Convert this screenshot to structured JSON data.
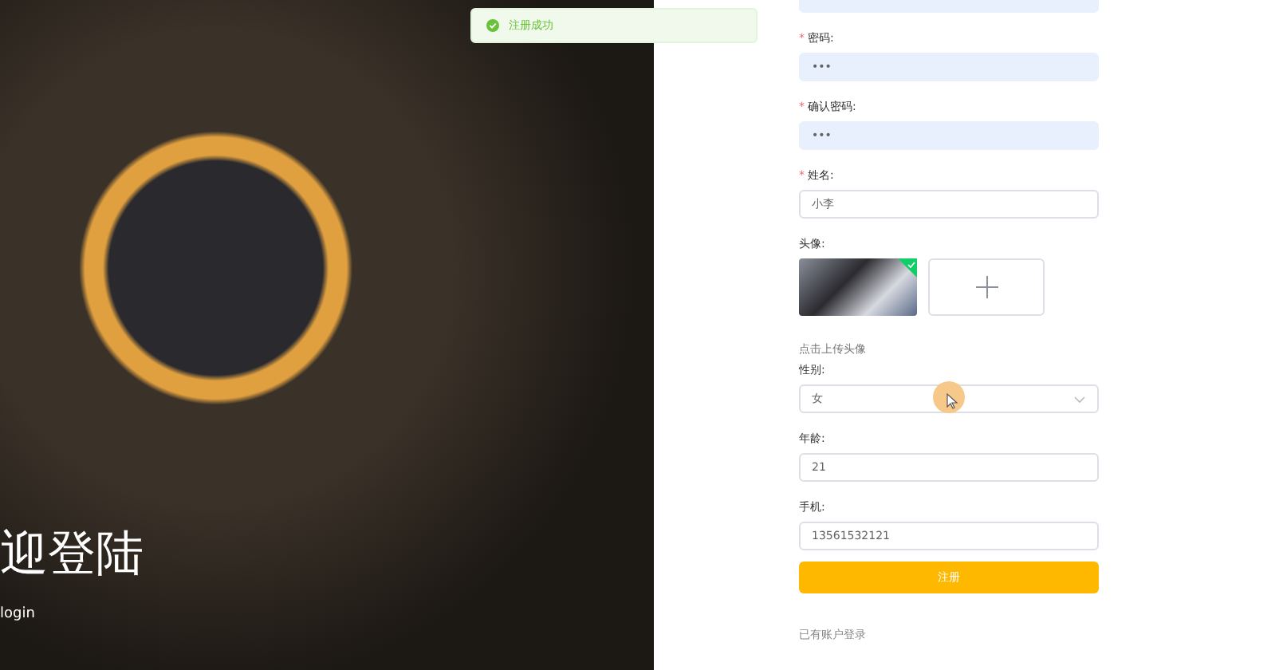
{
  "hero": {
    "title": "迎登陆",
    "subtitle": "login"
  },
  "toast": {
    "kind": "success",
    "text": "注册成功"
  },
  "form": {
    "fields": [
      {
        "kind": "input",
        "autofilled": true
      },
      {
        "kind": "input",
        "required_mark": "*",
        "label": "密码:",
        "value": "•••",
        "autofilled": true
      },
      {
        "kind": "input",
        "required_mark": "*",
        "label": "确认密码:",
        "value": "•••",
        "autofilled": true
      },
      {
        "kind": "input",
        "required_mark": "*",
        "label": "姓名:",
        "value": "小李",
        "autofilled": false
      },
      {
        "kind": "avatar",
        "label": "头像:",
        "uploaded": true,
        "hint": "点击上传头像"
      },
      {
        "kind": "select",
        "label": "性别:",
        "value": "女",
        "autofilled": false
      },
      {
        "kind": "input",
        "label": "年龄:",
        "value": "21",
        "autofilled": false
      },
      {
        "kind": "input",
        "label": "手机:",
        "value": "13561532121",
        "autofilled": false
      }
    ],
    "submit": "注册",
    "login_link": "已有账户登录"
  }
}
